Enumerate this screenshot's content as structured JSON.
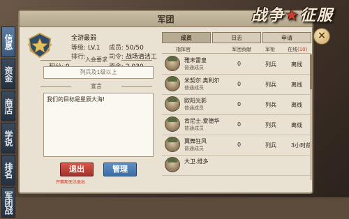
{
  "window": {
    "title": "军团"
  },
  "logo": {
    "text_left": "战争",
    "text_right": "征服"
  },
  "side_tabs": [
    {
      "label": "信息"
    },
    {
      "label": "资金"
    },
    {
      "label": "商店"
    },
    {
      "label": "学说"
    },
    {
      "label": "排名"
    },
    {
      "label": "军团战"
    }
  ],
  "profile": {
    "name": "全游最弱",
    "level_label": "等级:",
    "level_value": "LV.1",
    "members_label": "成员:",
    "members_value": "50/50",
    "rank_label": "排行:",
    "rank_value": "",
    "commander_label": "司令:",
    "commander_value": "战场清洁工",
    "points_label": "积分:",
    "points_value": "0",
    "funds_label": "资金:",
    "funds_value": "2.030"
  },
  "join_requirement": {
    "label": "入会要求",
    "value": "列兵及1级以上"
  },
  "declaration": {
    "label": "宣言",
    "text": "我们的目标是星辰大海!"
  },
  "buttons": {
    "exit": "退出",
    "manage": "管理",
    "exit_note": "开赛期无法退出"
  },
  "tabs": [
    {
      "label": "成员",
      "active": true
    },
    {
      "label": "日志",
      "active": false
    },
    {
      "label": "申请",
      "active": false
    }
  ],
  "table_headers": {
    "commander": "指挥官",
    "contribution": "军团贡献",
    "rank": "军衔",
    "online": "在线",
    "online_count": "(10)"
  },
  "members": [
    {
      "name": "雅末雷皇",
      "role": "普通成员",
      "contribution": "0",
      "rank": "列兵",
      "online": "离线"
    },
    {
      "name": "米契尔.奥利尔",
      "role": "普通成员",
      "contribution": "0",
      "rank": "列兵",
      "online": "离线"
    },
    {
      "name": "欧阳光影",
      "role": "普通成员",
      "contribution": "0",
      "rank": "列兵",
      "online": "离线"
    },
    {
      "name": "肯尼士.爱德华",
      "role": "普通成员",
      "contribution": "0",
      "rank": "列兵",
      "online": "离线"
    },
    {
      "name": "翼舞狂风",
      "role": "普通成员",
      "contribution": "0",
      "rank": "列兵",
      "online": "3小时前"
    },
    {
      "name": "大卫.维多",
      "role": "",
      "contribution": "",
      "rank": "",
      "online": ""
    }
  ],
  "colors": {
    "accent_red": "#c0392b",
    "tab_blue": "#3b5a7c"
  },
  "icons": {
    "close": "×",
    "badge": "star-badge-icon"
  }
}
